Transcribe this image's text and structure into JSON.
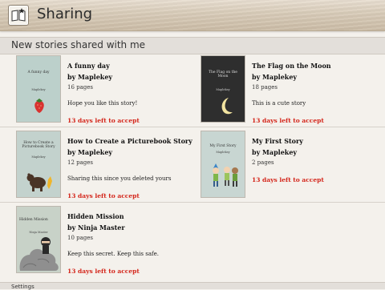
{
  "app": {
    "title": "Sharing"
  },
  "section": {
    "title": "New stories shared with me"
  },
  "stories": [
    {
      "title": "A funny day",
      "author": "by Maplekey",
      "pages": "16 pages",
      "message": "Hope you like this story!",
      "expiry": "13 days left to accept",
      "cover": {
        "title": "A funny day",
        "author": "Maplekey",
        "bg": "#bcd0cb",
        "art": "strawberry-icon"
      }
    },
    {
      "title": "The Flag on the Moon",
      "author": "by Maplekey",
      "pages": "18 pages",
      "message": "This is a cute story",
      "expiry": "13 days left to accept",
      "cover": {
        "title": "The Flag on the Moon",
        "author": "Maplekey",
        "bg": "#2e2e2e",
        "art": "crescent-moon-icon"
      }
    },
    {
      "title": "How to Create a Picturebook Story",
      "author": "by Maplekey",
      "pages": "12 pages",
      "message": "Sharing this since you deleted yours",
      "expiry": "13 days left to accept",
      "cover": {
        "title": "How to Create a Picturebook Story",
        "author": "Maplekey",
        "bg": "#c3d2cd",
        "art": "bear-icon"
      }
    },
    {
      "title": "My First Story",
      "author": "by Maplekey",
      "pages": "2 pages",
      "message": "",
      "expiry": "13 days left to accept",
      "cover": {
        "title": "My First Story",
        "author": "Maplekey",
        "bg": "#c8d6d2",
        "art": "kids-icon"
      }
    },
    {
      "title": "Hidden Mission",
      "author": "by Ninja Master",
      "pages": "10 pages",
      "message": "Keep this secret.  Keep this safe.",
      "expiry": "13 days left to accept",
      "cover": {
        "title": "Hidden Mission",
        "author": "Ninja Master",
        "bg": "#c8d2c8",
        "art": "ninja-icon"
      }
    }
  ],
  "footer": {
    "label": "Settings"
  },
  "colors": {
    "accent": "#d4261b",
    "header": "#d8cbb8"
  }
}
